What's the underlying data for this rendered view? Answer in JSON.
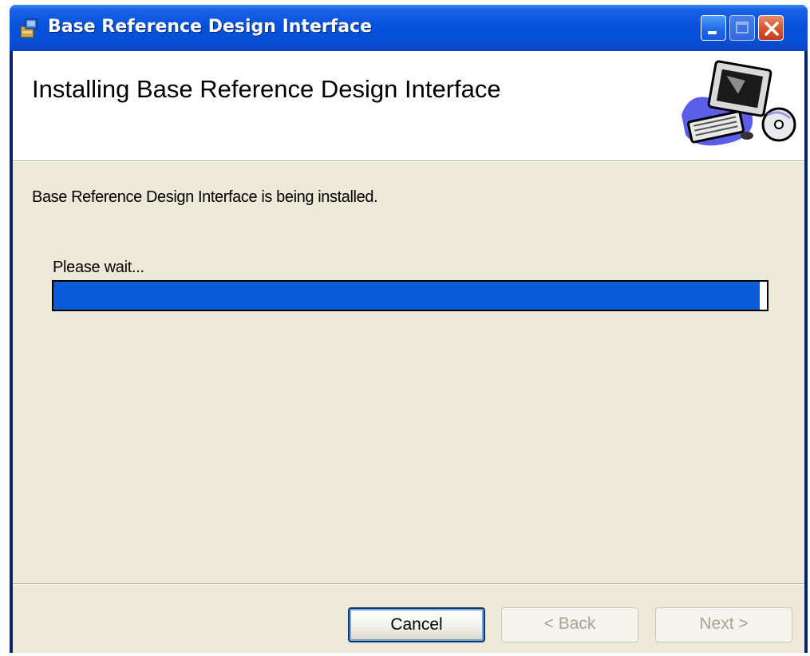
{
  "window": {
    "title": "Base Reference Design Interface",
    "icons": {
      "app": "installer-icon",
      "minimize": "minimize-icon",
      "maximize": "maximize-icon",
      "close": "close-icon"
    }
  },
  "banner": {
    "title": "Installing Base Reference Design Interface",
    "image": "computer-with-cd-icon"
  },
  "body": {
    "status_text": "Base Reference Design Interface is being installed.",
    "progress_label": "Please wait...",
    "progress_fraction": 0.99
  },
  "buttons": {
    "cancel": "Cancel",
    "back": "< Back",
    "next": "Next >"
  },
  "colors": {
    "titlebar": "#0752dd",
    "progress": "#0a5bd8",
    "dialog_bg": "#ece9d8"
  }
}
